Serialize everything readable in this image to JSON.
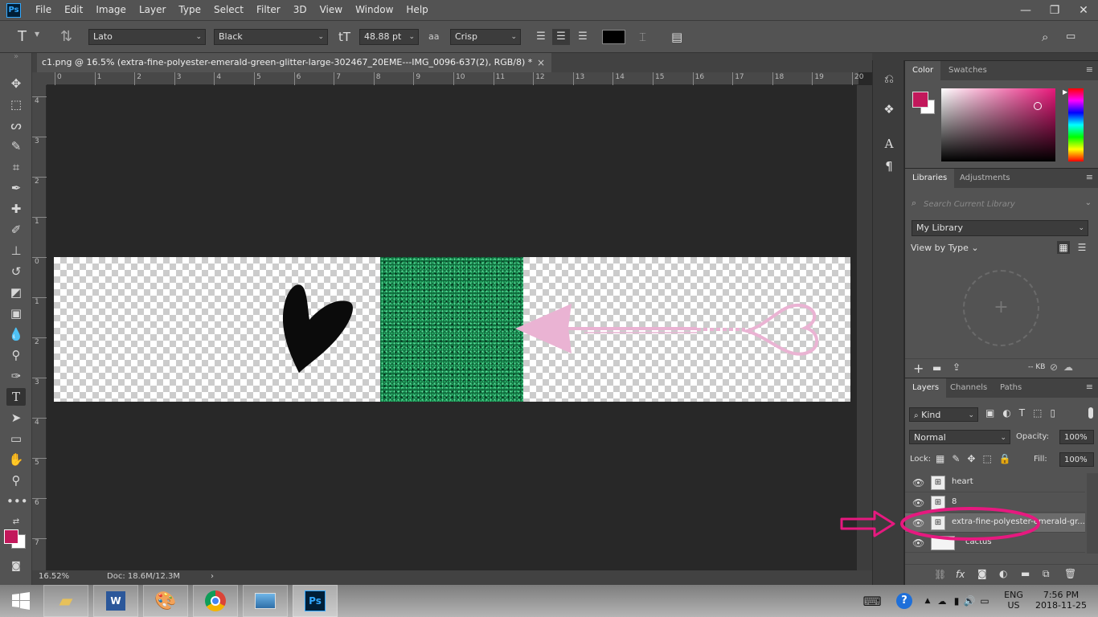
{
  "app": {
    "logo": "Ps",
    "menus": [
      "File",
      "Edit",
      "Image",
      "Layer",
      "Type",
      "Select",
      "Filter",
      "3D",
      "View",
      "Window",
      "Help"
    ]
  },
  "options_bar": {
    "font_family": "Lato",
    "font_style": "Black",
    "font_size": "48.88 pt",
    "aa_glyph": "aa",
    "anti_alias": "Crisp",
    "text_color": "#000000"
  },
  "document": {
    "tab_title": "c1.png @ 16.5% (extra-fine-polyester-emerald-green-glitter-large-302467_20EME---IMG_0096-637(2), RGB/8) *",
    "close_glyph": "×",
    "zoom": "16.52%",
    "doc_size": "Doc: 18.6M/12.3M",
    "status_arrow": "›"
  },
  "rulers": {
    "horizontal": [
      "0",
      "1",
      "2",
      "3",
      "4",
      "5",
      "6",
      "7",
      "8",
      "9",
      "10",
      "11",
      "12",
      "13",
      "14",
      "15",
      "16",
      "17",
      "18",
      "19",
      "20"
    ],
    "vertical": [
      "4",
      "3",
      "2",
      "1",
      "0",
      "1",
      "2",
      "3",
      "4",
      "5",
      "6",
      "7"
    ]
  },
  "color_panel": {
    "tabs": [
      "Color",
      "Swatches"
    ],
    "foreground": "#c2185b",
    "background": "#ffffff"
  },
  "libraries_panel": {
    "tabs": [
      "Libraries",
      "Adjustments"
    ],
    "search_placeholder": "Search Current Library",
    "library": "My Library",
    "view_by": "View by Type",
    "size": "-- KB"
  },
  "layers_panel": {
    "tabs": [
      "Layers",
      "Channels",
      "Paths"
    ],
    "filter": "Kind",
    "blend_mode": "Normal",
    "opacity_label": "Opacity:",
    "opacity": "100%",
    "lock_label": "Lock:",
    "fill_label": "Fill:",
    "fill": "100%",
    "layers": [
      {
        "name": "heart",
        "visible": true,
        "selected": false
      },
      {
        "name": "8",
        "visible": true,
        "selected": false
      },
      {
        "name": "extra-fine-polyester-emerald-gr...",
        "visible": true,
        "selected": true
      },
      {
        "name": "cactus",
        "visible": true,
        "selected": false
      }
    ],
    "fx_label": "fx"
  },
  "annotation": {
    "color": "#e6197f"
  },
  "taskbar": {
    "language": "ENG",
    "region": "US",
    "time": "7:56 PM",
    "date": "2018-11-25"
  }
}
